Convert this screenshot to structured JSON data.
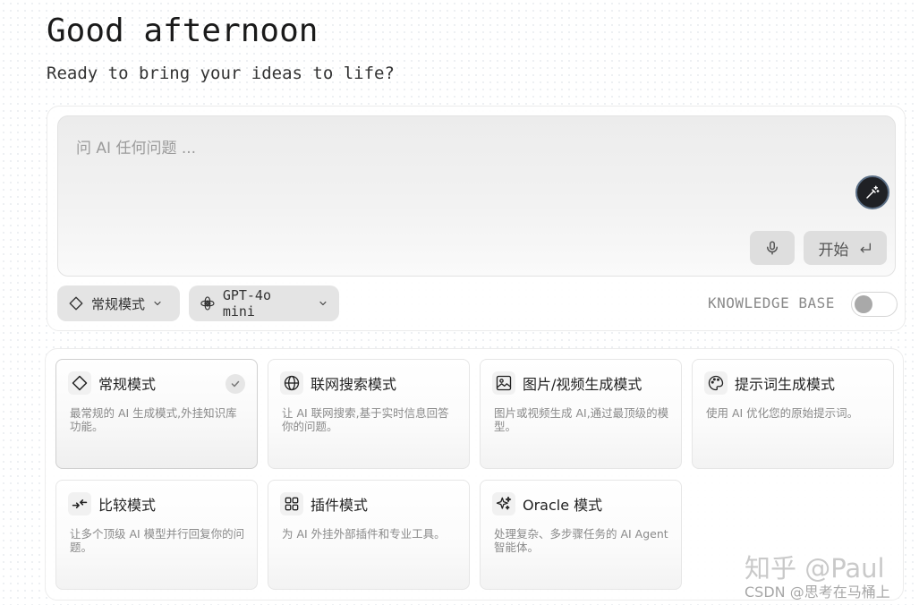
{
  "greeting": "Good afternoon",
  "subtitle": "Ready to bring your ideas to life?",
  "prompt": {
    "placeholder": "问 AI 任何问题 ...",
    "value": "",
    "start_label": "开始"
  },
  "toolbar": {
    "mode_label": "常规模式",
    "model_label": "GPT-4o mini",
    "knowledge_base_label": "KNOWLEDGE BASE",
    "knowledge_base_enabled": false
  },
  "modes": [
    {
      "title": "常规模式",
      "description": "最常规的 AI 生成模式,外挂知识库功能。",
      "icon": "diamond-icon",
      "selected": true
    },
    {
      "title": "联网搜索模式",
      "description": "让 AI 联网搜索,基于实时信息回答你的问题。",
      "icon": "globe-icon",
      "selected": false
    },
    {
      "title": "图片/视频生成模式",
      "description": "图片或视频生成 AI,通过最顶级的模型。",
      "icon": "image-icon",
      "selected": false
    },
    {
      "title": "提示词生成模式",
      "description": "使用 AI 优化您的原始提示词。",
      "icon": "palette-icon",
      "selected": false
    },
    {
      "title": "比较模式",
      "description": "让多个顶级 AI 模型并行回复你的问题。",
      "icon": "compare-arrows-icon",
      "selected": false
    },
    {
      "title": "插件模式",
      "description": "为 AI 外挂外部插件和专业工具。",
      "icon": "grid-icon",
      "selected": false
    },
    {
      "title": "Oracle 模式",
      "description": "处理复杂、多步骤任务的 AI Agent 智能体。",
      "icon": "sparkles-icon",
      "selected": false
    }
  ],
  "watermark": {
    "main": "知乎 @Paul",
    "sub": "CSDN @思考在马桶上"
  },
  "colors": {
    "accent_dark": "#1f2125",
    "accent_ring": "#5b6f86",
    "pill_bg": "#e4e4e4",
    "muted_text": "#8a8a8a"
  }
}
